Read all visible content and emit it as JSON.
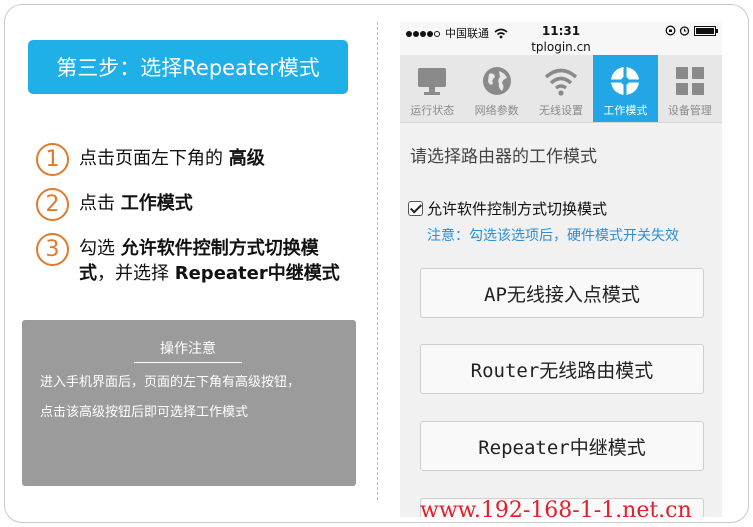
{
  "left": {
    "step_title": "第三步：选择Repeater模式",
    "steps": [
      {
        "num": "1",
        "pre": "点击页面左下角的 ",
        "bold": "高级",
        "post": ""
      },
      {
        "num": "2",
        "pre": "点击 ",
        "bold": "工作模式",
        "post": ""
      },
      {
        "num": "3",
        "pre": "勾选 ",
        "bold": "允许软件控制方式切换模式",
        "post": "，并选择 ",
        "bold2": "Repeater中继模式"
      }
    ],
    "note": {
      "title": "操作注意",
      "line1": "进入手机界面后，页面的左下角有高级按钮，",
      "line2": "点击该高级按钮后即可选择工作模式"
    }
  },
  "phone": {
    "carrier": "中国联通",
    "time": "11:31",
    "url": "tplogin.cn",
    "tabs": [
      {
        "label": "运行状态",
        "icon": "monitor-icon"
      },
      {
        "label": "网络参数",
        "icon": "globe-icon"
      },
      {
        "label": "无线设置",
        "icon": "wifi-icon"
      },
      {
        "label": "工作模式",
        "icon": "mode-icon"
      },
      {
        "label": "设备管理",
        "icon": "grid-icon"
      }
    ],
    "active_tab": "工作模式",
    "mode_title": "请选择路由器的工作模式",
    "checkbox_label": "允许软件控制方式切换模式",
    "hint": "注意：勾选该选项后，硬件模式开关失效",
    "buttons": [
      "AP无线接入点模式",
      "Router无线路由模式",
      "Repeater中继模式"
    ]
  },
  "watermark": "www.192-168-1-1.net.cn",
  "colors": {
    "accent": "#1fb0e8",
    "step_number": "#e07a2a",
    "hint": "#2b8fd8",
    "watermark": "#e0202a"
  }
}
